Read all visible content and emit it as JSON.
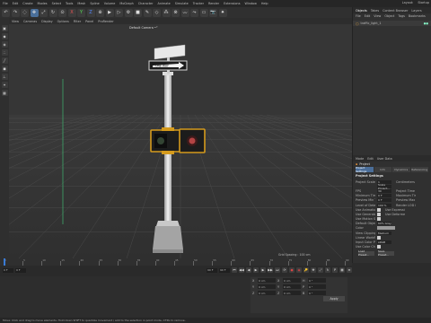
{
  "menubar": {
    "items": [
      "File",
      "Edit",
      "Create",
      "Modes",
      "Select",
      "Tools",
      "Mesh",
      "Spline",
      "Volume",
      "MoGraph",
      "Character",
      "Animate",
      "Simulate",
      "Tracker",
      "Render",
      "Extensions",
      "Window",
      "Help"
    ],
    "right": [
      "Layout:",
      "Startup"
    ]
  },
  "toolbar": {
    "icons": [
      "undo-icon",
      "redo-icon",
      "live-select-icon",
      "move-icon",
      "scale-icon",
      "rotate-icon",
      "recent-icon",
      "x-axis-icon",
      "y-axis-icon",
      "z-axis-icon",
      "coord-icon",
      "render-view-icon",
      "render-pv-icon",
      "render-settings-icon",
      "cube-icon",
      "pen-icon",
      "subdiv-icon",
      "array-icon",
      "boole-icon",
      "spline-icon",
      "deformer-icon",
      "floor-icon",
      "camera-icon",
      "light-icon"
    ]
  },
  "viewport": {
    "menu": [
      "View",
      "Cameras",
      "Display",
      "Options",
      "Filter",
      "Panel",
      "ProRender"
    ],
    "camera_label": "Default Camera •°",
    "grid_spacing": "Grid Spacing : 100 cm",
    "sign_text": "ONE WAY"
  },
  "objects_panel": {
    "tabs": [
      "Objects",
      "Takes",
      "Content Browser",
      "Layers"
    ],
    "menu": [
      "File",
      "Edit",
      "View",
      "Object",
      "Tags",
      "Bookmarks"
    ],
    "object_name": "traffic_light_1"
  },
  "attributes": {
    "menu": [
      "Mode",
      "Edit",
      "User Data"
    ],
    "title": "Project",
    "tabs": [
      "Project Settings",
      "Info",
      "Dynamics",
      "Referencing"
    ],
    "section": "Project Settings",
    "rows": [
      {
        "k": "Project Scale",
        "v": "1",
        "k2": "Centimeters"
      },
      {
        "k": "",
        "v": "Scale Project..."
      },
      {
        "k": "FPS",
        "v": "30",
        "k2": "Project Time"
      },
      {
        "k": "Minimum Time",
        "v": "0 F",
        "k2": "Maximum Time"
      },
      {
        "k": "Preview Min Time",
        "v": "0 F",
        "k2": "Preview Max Time"
      },
      {
        "k": "Level of Detail",
        "v": "100 %",
        "k2": "Render LOD in Editor"
      },
      {
        "k": "Use Animation",
        "v": "",
        "k2": "Use Expression"
      },
      {
        "k": "Use Generators",
        "v": "",
        "k2": "Use Deformers"
      },
      {
        "k": "Use Motion System",
        "v": ""
      },
      {
        "k": "Default Object Color",
        "v": "60% Gray"
      },
      {
        "k": "Color",
        "v": ""
      },
      {
        "k": "View Clipping",
        "v": "Medium"
      },
      {
        "k": "Linear Workflow",
        "v": ""
      },
      {
        "k": "Input Color Profile",
        "v": "sRGB"
      },
      {
        "k": "Use Color Channel for Node Material",
        "v": ""
      }
    ],
    "buttons": [
      "Load Preset...",
      "Save Preset..."
    ]
  },
  "timeline": {
    "ticks": [
      "0",
      "5",
      "10",
      "15",
      "20",
      "25",
      "30",
      "35",
      "40",
      "45",
      "50",
      "55",
      "60",
      "65",
      "70",
      "75",
      "80",
      "85",
      "90"
    ],
    "start": "0 F",
    "current": "0 F",
    "end": "90 F",
    "end2": "90 F"
  },
  "coordinates": {
    "rows": [
      {
        "a": "X",
        "av": "0 cm",
        "b": "X",
        "bv": "0 cm",
        "c": "H",
        "cv": "0 °"
      },
      {
        "a": "Y",
        "av": "0 cm",
        "b": "Y",
        "bv": "0 cm",
        "c": "P",
        "cv": "0 °"
      },
      {
        "a": "Z",
        "av": "0 cm",
        "b": "Z",
        "bv": "0 cm",
        "c": "B",
        "cv": "0 °"
      }
    ],
    "apply": "Apply"
  },
  "status": "Move: Click and drag to move elements. Hold down SHIFT to quantize movement / add to the selection in point mode, CTRL to remove."
}
